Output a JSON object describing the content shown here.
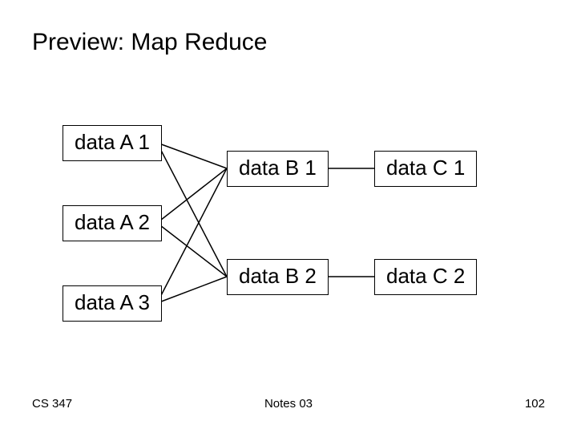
{
  "title": "Preview: Map Reduce",
  "boxes": {
    "a1": "data A 1",
    "a2": "data A 2",
    "a3": "data A 3",
    "b1": "data B 1",
    "b2": "data B 2",
    "c1": "data C 1",
    "c2": "data C 2"
  },
  "footer": {
    "course": "CS 347",
    "notes": "Notes 03",
    "page": "102"
  },
  "connectors": [
    {
      "from": "a1",
      "to": "b1"
    },
    {
      "from": "a2",
      "to": "b1"
    },
    {
      "from": "a3",
      "to": "b1"
    },
    {
      "from": "a1",
      "to": "b2"
    },
    {
      "from": "a2",
      "to": "b2"
    },
    {
      "from": "a3",
      "to": "b2"
    },
    {
      "from": "b1",
      "to": "c1"
    },
    {
      "from": "b2",
      "to": "c2"
    }
  ]
}
